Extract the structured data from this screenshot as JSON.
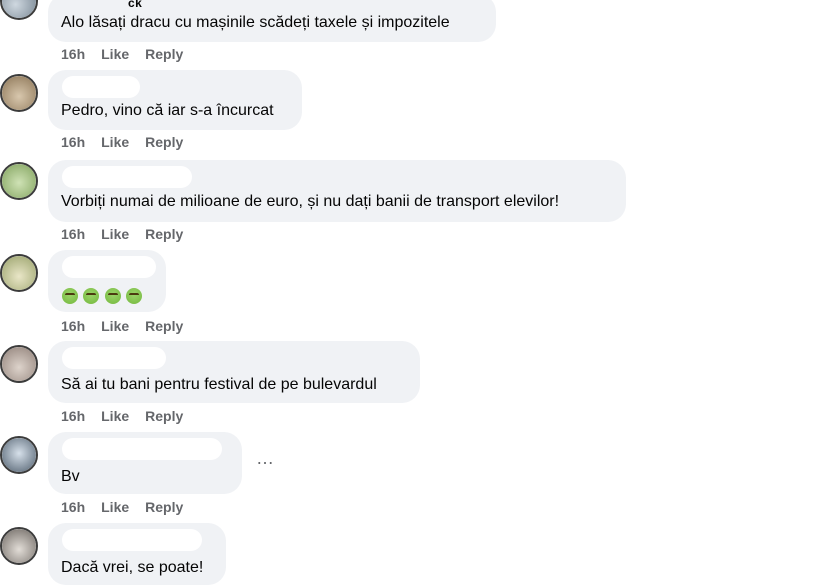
{
  "comments": [
    {
      "name_fragment": "ck",
      "text": "Alo lăsați dracu cu mașinile scădeți taxele și impozitele",
      "time": "16h",
      "like": "Like",
      "reply": "Reply"
    },
    {
      "text": "Pedro, vino că iar s-a încurcat",
      "time": "16h",
      "like": "Like",
      "reply": "Reply"
    },
    {
      "text": "Vorbiți numai de milioane de euro, și nu dați banii de transport elevilor!",
      "time": "16h",
      "like": "Like",
      "reply": "Reply"
    },
    {
      "text": "",
      "emoji_count": 4,
      "time": "16h",
      "like": "Like",
      "reply": "Reply"
    },
    {
      "text": "Să ai tu bani pentru festival de pe bulevardul",
      "time": "16h",
      "like": "Like",
      "reply": "Reply"
    },
    {
      "text": "Bv",
      "time": "16h",
      "like": "Like",
      "reply": "Reply",
      "more": "…"
    },
    {
      "text": "Dacă vrei, se poate!"
    }
  ],
  "icons": {
    "options": "more-options-icon",
    "reaction": "nauseated-face-emoji"
  }
}
